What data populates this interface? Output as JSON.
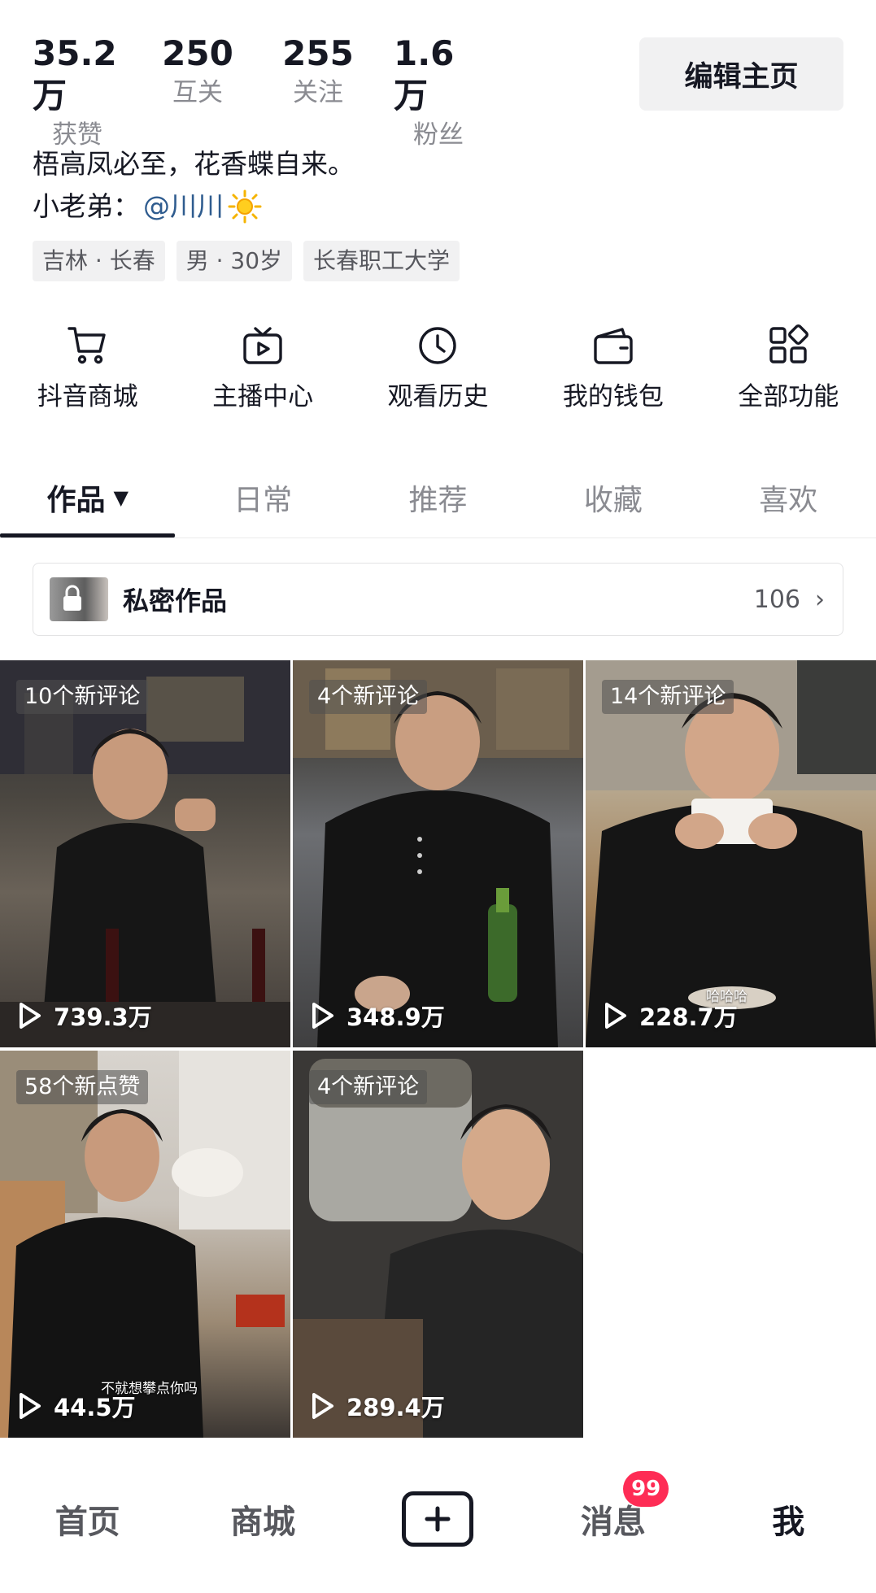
{
  "stats": [
    {
      "value": "35.2万",
      "label": "获赞"
    },
    {
      "value": "250",
      "label": "互关"
    },
    {
      "value": "255",
      "label": "关注"
    },
    {
      "value": "1.6万",
      "label": "粉丝"
    }
  ],
  "edit_profile_label": "编辑主页",
  "bio": {
    "line1": "梧高凤必至，花香蝶自来。",
    "line2_prefix": "小老弟：",
    "mention": "@川川"
  },
  "tags": [
    "吉林 · 长春",
    "男 · 30岁",
    "长春职工大学"
  ],
  "functions": [
    {
      "label": "抖音商城",
      "icon": "cart-icon"
    },
    {
      "label": "主播中心",
      "icon": "tv-play-icon"
    },
    {
      "label": "观看历史",
      "icon": "clock-icon"
    },
    {
      "label": "我的钱包",
      "icon": "wallet-icon"
    },
    {
      "label": "全部功能",
      "icon": "grid-apps-icon"
    }
  ],
  "tabs": [
    {
      "label": "作品",
      "active": true
    },
    {
      "label": "日常",
      "active": false
    },
    {
      "label": "推荐",
      "active": false
    },
    {
      "label": "收藏",
      "active": false
    },
    {
      "label": "喜欢",
      "active": false
    }
  ],
  "private_works": {
    "title": "私密作品",
    "count": "106"
  },
  "videos": [
    {
      "badge": "10个新评论",
      "plays": "739.3万"
    },
    {
      "badge": "4个新评论",
      "plays": "348.9万"
    },
    {
      "badge": "14个新评论",
      "plays": "228.7万",
      "overlay_text": "哈哈哈"
    },
    {
      "badge": "58个新点赞",
      "plays": "44.5万",
      "overlay_text": "不就想攀点你吗"
    },
    {
      "badge": "4个新评论",
      "plays": "289.4万"
    }
  ],
  "bottom_nav": {
    "home": "首页",
    "mall": "商城",
    "messages": "消息",
    "messages_badge": "99",
    "me": "我"
  },
  "colors": {
    "accent": "#fe2c55",
    "mention": "#2f5c8f",
    "text": "#161823",
    "muted": "#8a8b91"
  }
}
